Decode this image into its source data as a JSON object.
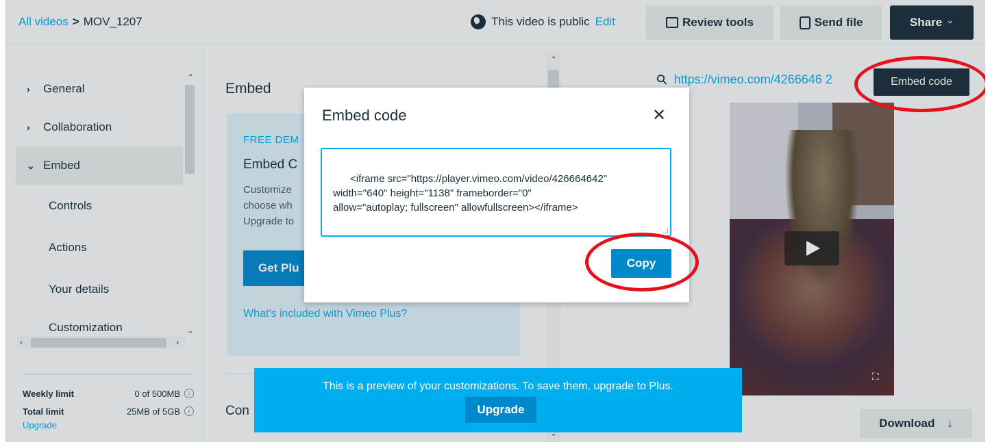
{
  "breadcrumb": {
    "root": "All videos",
    "separator": ">",
    "current": "MOV_1207"
  },
  "visibility": {
    "text": "This video is public",
    "edit": "Edit"
  },
  "toolbar": {
    "review": "Review tools",
    "send": "Send file",
    "share": "Share",
    "share_chevron": "⌄"
  },
  "sidebar": {
    "sections": [
      {
        "label": "General",
        "chevron": "›"
      },
      {
        "label": "Collaboration",
        "chevron": "›"
      },
      {
        "label": "Embed",
        "chevron": "⌄"
      }
    ],
    "sub_items": [
      "Controls",
      "Actions",
      "Your details",
      "Customization"
    ],
    "limits": [
      {
        "label": "Weekly limit",
        "value": "0 of 500MB"
      },
      {
        "label": "Total limit",
        "value": "25MB of 5GB"
      }
    ],
    "upgrade_link": "Upgrade"
  },
  "middle": {
    "title": "Embed",
    "promo": {
      "kicker": "FREE DEM",
      "title": "Embed C",
      "body": "Customize\nchoose wh\nUpgrade to",
      "button": "Get Plu",
      "link": "What's included with Vimeo Plus?"
    },
    "sub_heading": "Con"
  },
  "right": {
    "url": "https://vimeo.com/4266646  2",
    "embed_code_button": "Embed code",
    "download": "Download",
    "download_icon": "↓"
  },
  "modal": {
    "title": "Embed code",
    "close": "✕",
    "code": "<iframe src=\"https://player.vimeo.com/video/426664642\"\nwidth=\"640\" height=\"1138\" frameborder=\"0\"\nallow=\"autoplay; fullscreen\" allowfullscreen></iframe>",
    "copy": "Copy"
  },
  "toast": {
    "message": "This is a preview of your customizations. To save them, upgrade to Plus.",
    "button": "Upgrade"
  },
  "colors": {
    "accent": "#00adef",
    "dark": "#1a2e3b",
    "button": "#0088cc",
    "annotation": "#e3121b"
  }
}
